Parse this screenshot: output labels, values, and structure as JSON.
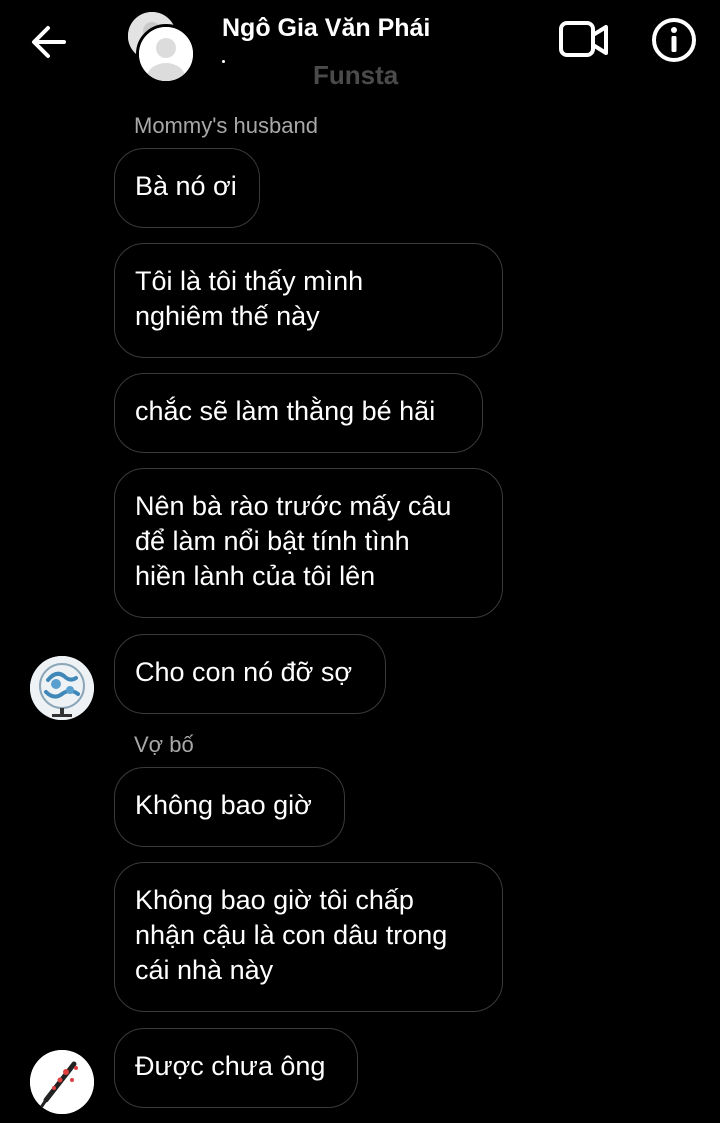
{
  "header": {
    "title": "Ngô Gia Văn Phái",
    "subtitle": "Funsta",
    "back_icon": "arrow-left-icon",
    "video_icon": "video-camera-icon",
    "info_icon": "info-icon"
  },
  "messages": [
    {
      "sender": "Mommy's husband",
      "text": "Bà nó ơi"
    },
    {
      "text": "Tôi là tôi thấy mình\nnghiêm thế này"
    },
    {
      "text": "chắc sẽ làm thằng bé hãi"
    },
    {
      "text": "Nên bà rào trước mấy câu\nđể làm nổi bật tính tình\nhiền lành của tôi lên"
    },
    {
      "text": "Cho con nó đỡ sợ"
    },
    {
      "sender": "Vợ bố",
      "text": "Không bao giờ"
    },
    {
      "text": "Không bao giờ tôi chấp\nnhận cậu là con dâu trong\ncái nhà này"
    },
    {
      "text": "Được chưa ông"
    }
  ],
  "colors": {
    "background": "#000000",
    "bubble_border": "#3a3a3a",
    "sender_name": "#a8a8a8",
    "subtitle": "#4b4b4b"
  }
}
